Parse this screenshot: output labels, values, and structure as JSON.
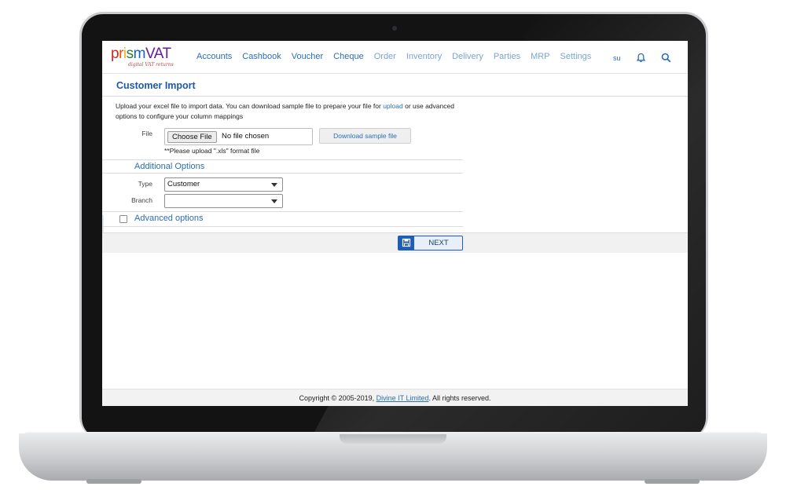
{
  "logo": {
    "text": "prismVAT",
    "tagline": "digital VAT returns",
    "letters": [
      {
        "ch": "p",
        "color": "#c62828"
      },
      {
        "ch": "r",
        "color": "#e65100"
      },
      {
        "ch": "i",
        "color": "#f9a825"
      },
      {
        "ch": "s",
        "color": "#2e7d32"
      },
      {
        "ch": "m",
        "color": "#1565c0"
      },
      {
        "ch": "V",
        "color": "#6a1b9a"
      },
      {
        "ch": "A",
        "color": "#6a1b9a"
      },
      {
        "ch": "T",
        "color": "#6a1b9a"
      }
    ]
  },
  "nav": {
    "items": [
      "Accounts",
      "Cashbook",
      "Voucher",
      "Cheque",
      "Order",
      "Inventory",
      "Delivery",
      "Parties",
      "MRP",
      "Settings"
    ],
    "user": "su"
  },
  "page": {
    "title": "Customer Import",
    "description_part1": "Upload your excel file to import data. You can download sample file to prepare your file for ",
    "description_link": "upload",
    "description_part2": " or use advanced options to configure your column mappings"
  },
  "file": {
    "label": "File",
    "choose_label": "Choose File",
    "status": "No file chosen",
    "download_label": "Download sample file",
    "hint": "**Please upload \".xls\" format file"
  },
  "additional": {
    "heading": "Additional Options",
    "type_label": "Type",
    "type_value": "Customer",
    "branch_label": "Branch",
    "branch_value": ""
  },
  "advanced": {
    "label": "Advanced options",
    "checked": false
  },
  "actions": {
    "next_label": "NEXT"
  },
  "footer": {
    "prefix": "Copyright © 2005-2019, ",
    "company": "Divine IT Limited",
    "suffix": ". All rights reserved."
  },
  "colors": {
    "accent": "#2a6ebb",
    "title": "#1f5aa6",
    "button": "#1e5fb5"
  }
}
